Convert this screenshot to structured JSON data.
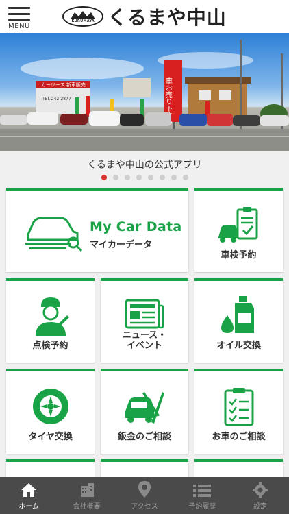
{
  "header": {
    "menu_label": "MENU",
    "logo_badge_text": "KURUMAYA",
    "logo_text": "くるまや中山"
  },
  "hero": {
    "shop_sign": "カーリース 新車販売",
    "shop_phone": "TEL 242-2877",
    "banner_text": "車お売り下さい"
  },
  "slider": {
    "caption": "くるまや中山の公式アプリ",
    "dot_count": 8,
    "active_index": 0
  },
  "tiles": {
    "mycar": {
      "title_en": "My Car Data",
      "title_jp": "マイカーデータ",
      "icon": "car-search-icon"
    },
    "shaken": {
      "label": "車検予約",
      "icon": "car-checklist-icon"
    },
    "tenken": {
      "label": "点検予約",
      "icon": "mechanic-icon"
    },
    "news": {
      "label": "ニュース・\nイベント",
      "icon": "newspaper-icon"
    },
    "oil": {
      "label": "オイル交換",
      "icon": "oil-bottle-icon"
    },
    "tire": {
      "label": "タイヤ交換",
      "icon": "tire-icon"
    },
    "bankin": {
      "label": "鈑金のご相談",
      "icon": "car-repair-icon"
    },
    "consult": {
      "label": "お車のご相談",
      "icon": "checklist-icon"
    }
  },
  "nav": {
    "items": [
      {
        "label": "ホーム",
        "icon": "home-icon",
        "active": true
      },
      {
        "label": "会社概要",
        "icon": "building-icon",
        "active": false
      },
      {
        "label": "アクセス",
        "icon": "map-pin-icon",
        "active": false
      },
      {
        "label": "予約履歴",
        "icon": "list-icon",
        "active": false
      },
      {
        "label": "設定",
        "icon": "gear-icon",
        "active": false
      }
    ]
  },
  "colors": {
    "accent": "#1aa346",
    "nav_bg": "#4a4a4a",
    "dot_active": "#e03030"
  }
}
